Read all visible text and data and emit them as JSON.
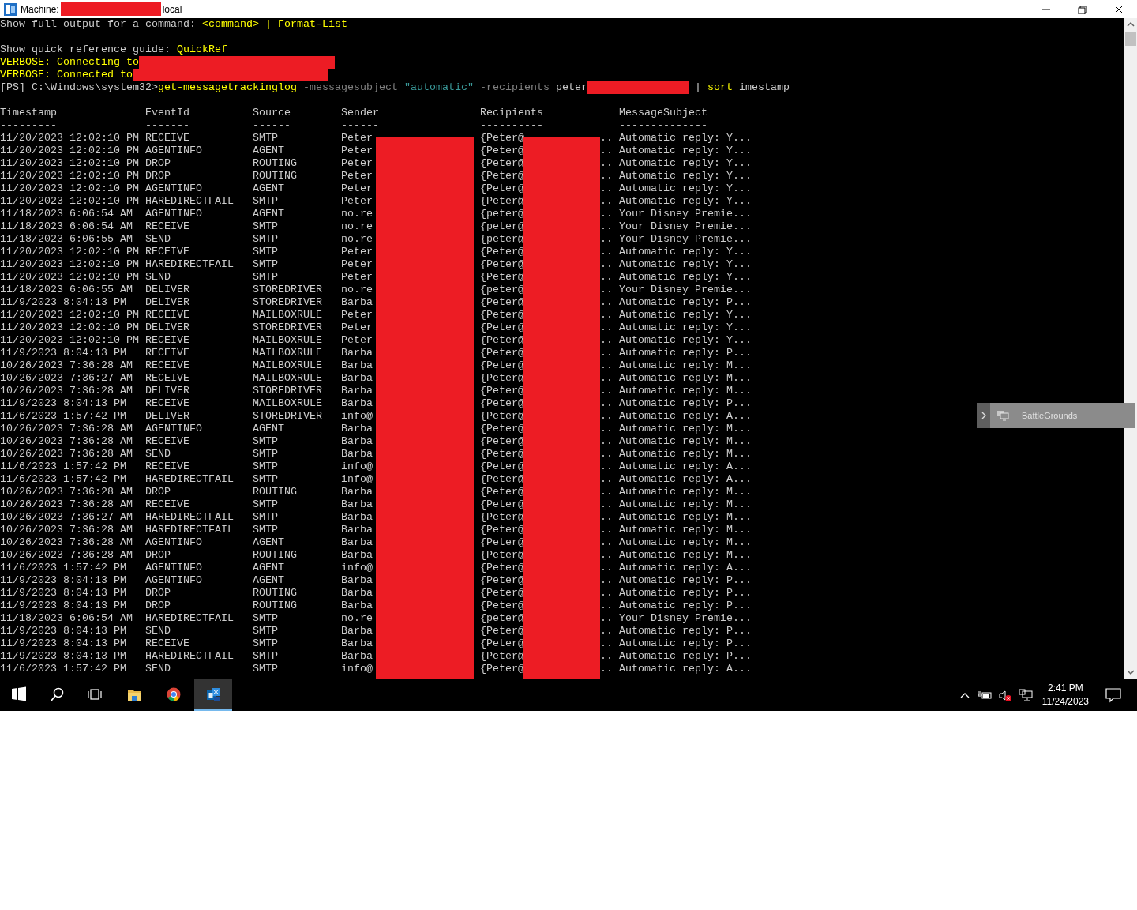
{
  "window": {
    "title": [
      {
        "kind": "plain",
        "text": "Machine:"
      },
      {
        "kind": "redaction"
      },
      {
        "kind": "plain",
        "text": "local"
      }
    ]
  },
  "console": {
    "lines": [
      {
        "blank_before": false,
        "segments": [
          {
            "kind": "plain",
            "text": "Show full output for a command: "
          },
          {
            "kind": "command",
            "text": "<command> | Format-List"
          }
        ]
      },
      {
        "blank_before": true,
        "segments": [
          {
            "kind": "plain",
            "text": "Show quick reference guide: "
          },
          {
            "kind": "command",
            "text": "QuickRef"
          }
        ]
      },
      {
        "blank_before": false,
        "segments": [
          {
            "kind": "command",
            "text": "VERBOSE: Connecting to"
          },
          {
            "kind": "redaction"
          }
        ]
      },
      {
        "blank_before": false,
        "segments": [
          {
            "kind": "command",
            "text": "VERBOSE: Connected to"
          },
          {
            "kind": "redaction"
          }
        ]
      },
      {
        "blank_before": false,
        "segments": [
          {
            "kind": "plain",
            "text": "[PS] C:\\Windows\\system32>"
          },
          {
            "kind": "command",
            "text": "get-messagetrackinglog"
          },
          {
            "kind": "parameter",
            "text": " -messagesubject "
          },
          {
            "kind": "string",
            "text": "\"automatic\""
          },
          {
            "kind": "parameter",
            "text": " -recipients "
          },
          {
            "kind": "plain",
            "text": "peter"
          },
          {
            "kind": "redaction"
          },
          {
            "kind": "plain",
            "text": " | "
          },
          {
            "kind": "command",
            "text": "sort"
          },
          {
            "kind": "plain",
            "text": " imestamp"
          }
        ]
      }
    ],
    "table": {
      "columns": [
        {
          "label": "Timestamp",
          "rule": "---------"
        },
        {
          "label": "EventId",
          "rule": "-------"
        },
        {
          "label": "Source",
          "rule": "------"
        },
        {
          "label": "Sender",
          "rule": "------"
        },
        {
          "label": "Recipients",
          "rule": "----------"
        },
        {
          "label": "MessageSubject",
          "rule": "--------------"
        }
      ],
      "rows": [
        {
          "timestamp": "11/20/2023 12:02:10 PM",
          "event_id": "RECEIVE",
          "source": "SMTP",
          "sender": "Peter",
          "recipients": "{Peter@",
          "recipients_end": "..",
          "subject": "Automatic reply: Y..."
        },
        {
          "timestamp": "11/20/2023 12:02:10 PM",
          "event_id": "AGENTINFO",
          "source": "AGENT",
          "sender": "Peter",
          "recipients": "{Peter@",
          "recipients_end": "..",
          "subject": "Automatic reply: Y..."
        },
        {
          "timestamp": "11/20/2023 12:02:10 PM",
          "event_id": "DROP",
          "source": "ROUTING",
          "sender": "Peter",
          "recipients": "{Peter@",
          "recipients_end": "..",
          "subject": "Automatic reply: Y..."
        },
        {
          "timestamp": "11/20/2023 12:02:10 PM",
          "event_id": "DROP",
          "source": "ROUTING",
          "sender": "Peter",
          "recipients": "{Peter@",
          "recipients_end": "..",
          "subject": "Automatic reply: Y..."
        },
        {
          "timestamp": "11/20/2023 12:02:10 PM",
          "event_id": "AGENTINFO",
          "source": "AGENT",
          "sender": "Peter",
          "recipients": "{Peter@",
          "recipients_end": "..",
          "subject": "Automatic reply: Y..."
        },
        {
          "timestamp": "11/20/2023 12:02:10 PM",
          "event_id": "HAREDIRECTFAIL",
          "source": "SMTP",
          "sender": "Peter",
          "recipients": "{Peter@",
          "recipients_end": "..",
          "subject": "Automatic reply: Y..."
        },
        {
          "timestamp": "11/18/2023 6:06:54 AM",
          "event_id": "AGENTINFO",
          "source": "AGENT",
          "sender": "no.re",
          "recipients": "{peter@",
          "recipients_end": "..",
          "subject": "Your Disney Premie..."
        },
        {
          "timestamp": "11/18/2023 6:06:54 AM",
          "event_id": "RECEIVE",
          "source": "SMTP",
          "sender": "no.re",
          "recipients": "{peter@",
          "recipients_end": "..",
          "subject": "Your Disney Premie..."
        },
        {
          "timestamp": "11/18/2023 6:06:55 AM",
          "event_id": "SEND",
          "source": "SMTP",
          "sender": "no.re",
          "recipients": "{peter@",
          "recipients_end": "..",
          "subject": "Your Disney Premie..."
        },
        {
          "timestamp": "11/20/2023 12:02:10 PM",
          "event_id": "RECEIVE",
          "source": "SMTP",
          "sender": "Peter",
          "recipients": "{Peter@",
          "recipients_end": "..",
          "subject": "Automatic reply: Y..."
        },
        {
          "timestamp": "11/20/2023 12:02:10 PM",
          "event_id": "HAREDIRECTFAIL",
          "source": "SMTP",
          "sender": "Peter",
          "recipients": "{Peter@",
          "recipients_end": "..",
          "subject": "Automatic reply: Y..."
        },
        {
          "timestamp": "11/20/2023 12:02:10 PM",
          "event_id": "SEND",
          "source": "SMTP",
          "sender": "Peter",
          "recipients": "{Peter@",
          "recipients_end": "..",
          "subject": "Automatic reply: Y..."
        },
        {
          "timestamp": "11/18/2023 6:06:55 AM",
          "event_id": "DELIVER",
          "source": "STOREDRIVER",
          "sender": "no.re",
          "recipients": "{peter@",
          "recipients_end": "..",
          "subject": "Your Disney Premie..."
        },
        {
          "timestamp": "11/9/2023 8:04:13 PM",
          "event_id": "DELIVER",
          "source": "STOREDRIVER",
          "sender": "Barba",
          "recipients": "{Peter@",
          "recipients_end": "..",
          "subject": "Automatic reply: P..."
        },
        {
          "timestamp": "11/20/2023 12:02:10 PM",
          "event_id": "RECEIVE",
          "source": "MAILBOXRULE",
          "sender": "Peter",
          "recipients": "{Peter@",
          "recipients_end": "..",
          "subject": "Automatic reply: Y..."
        },
        {
          "timestamp": "11/20/2023 12:02:10 PM",
          "event_id": "DELIVER",
          "source": "STOREDRIVER",
          "sender": "Peter",
          "recipients": "{Peter@",
          "recipients_end": "..",
          "subject": "Automatic reply: Y..."
        },
        {
          "timestamp": "11/20/2023 12:02:10 PM",
          "event_id": "RECEIVE",
          "source": "MAILBOXRULE",
          "sender": "Peter",
          "recipients": "{Peter@",
          "recipients_end": "..",
          "subject": "Automatic reply: Y..."
        },
        {
          "timestamp": "11/9/2023 8:04:13 PM",
          "event_id": "RECEIVE",
          "source": "MAILBOXRULE",
          "sender": "Barba",
          "recipients": "{Peter@",
          "recipients_end": "..",
          "subject": "Automatic reply: P..."
        },
        {
          "timestamp": "10/26/2023 7:36:28 AM",
          "event_id": "RECEIVE",
          "source": "MAILBOXRULE",
          "sender": "Barba",
          "recipients": "{Peter@",
          "recipients_end": "..",
          "subject": "Automatic reply: M..."
        },
        {
          "timestamp": "10/26/2023 7:36:27 AM",
          "event_id": "RECEIVE",
          "source": "MAILBOXRULE",
          "sender": "Barba",
          "recipients": "{Peter@",
          "recipients_end": "..",
          "subject": "Automatic reply: M..."
        },
        {
          "timestamp": "10/26/2023 7:36:28 AM",
          "event_id": "DELIVER",
          "source": "STOREDRIVER",
          "sender": "Barba",
          "recipients": "{Peter@",
          "recipients_end": "..",
          "subject": "Automatic reply: M..."
        },
        {
          "timestamp": "11/9/2023 8:04:13 PM",
          "event_id": "RECEIVE",
          "source": "MAILBOXRULE",
          "sender": "Barba",
          "recipients": "{Peter@",
          "recipients_end": "..",
          "subject": "Automatic reply: P..."
        },
        {
          "timestamp": "11/6/2023 1:57:42 PM",
          "event_id": "DELIVER",
          "source": "STOREDRIVER",
          "sender": "info@",
          "recipients": "{Peter@",
          "recipients_end": "..",
          "subject": "Automatic reply: A..."
        },
        {
          "timestamp": "10/26/2023 7:36:28 AM",
          "event_id": "AGENTINFO",
          "source": "AGENT",
          "sender": "Barba",
          "recipients": "{Peter@",
          "recipients_end": "..",
          "subject": "Automatic reply: M..."
        },
        {
          "timestamp": "10/26/2023 7:36:28 AM",
          "event_id": "RECEIVE",
          "source": "SMTP",
          "sender": "Barba",
          "recipients": "{Peter@",
          "recipients_end": "..",
          "subject": "Automatic reply: M..."
        },
        {
          "timestamp": "10/26/2023 7:36:28 AM",
          "event_id": "SEND",
          "source": "SMTP",
          "sender": "Barba",
          "recipients": "{Peter@",
          "recipients_end": "..",
          "subject": "Automatic reply: M..."
        },
        {
          "timestamp": "11/6/2023 1:57:42 PM",
          "event_id": "RECEIVE",
          "source": "SMTP",
          "sender": "info@",
          "recipients": "{Peter@",
          "recipients_end": "..",
          "subject": "Automatic reply: A..."
        },
        {
          "timestamp": "11/6/2023 1:57:42 PM",
          "event_id": "HAREDIRECTFAIL",
          "source": "SMTP",
          "sender": "info@",
          "recipients": "{Peter@",
          "recipients_end": "..",
          "subject": "Automatic reply: A..."
        },
        {
          "timestamp": "10/26/2023 7:36:28 AM",
          "event_id": "DROP",
          "source": "ROUTING",
          "sender": "Barba",
          "recipients": "{Peter@",
          "recipients_end": "..",
          "subject": "Automatic reply: M..."
        },
        {
          "timestamp": "10/26/2023 7:36:28 AM",
          "event_id": "RECEIVE",
          "source": "SMTP",
          "sender": "Barba",
          "recipients": "{Peter@",
          "recipients_end": "..",
          "subject": "Automatic reply: M..."
        },
        {
          "timestamp": "10/26/2023 7:36:27 AM",
          "event_id": "HAREDIRECTFAIL",
          "source": "SMTP",
          "sender": "Barba",
          "recipients": "{Peter@",
          "recipients_end": "..",
          "subject": "Automatic reply: M..."
        },
        {
          "timestamp": "10/26/2023 7:36:28 AM",
          "event_id": "HAREDIRECTFAIL",
          "source": "SMTP",
          "sender": "Barba",
          "recipients": "{Peter@",
          "recipients_end": "..",
          "subject": "Automatic reply: M..."
        },
        {
          "timestamp": "10/26/2023 7:36:28 AM",
          "event_id": "AGENTINFO",
          "source": "AGENT",
          "sender": "Barba",
          "recipients": "{Peter@",
          "recipients_end": "..",
          "subject": "Automatic reply: M..."
        },
        {
          "timestamp": "10/26/2023 7:36:28 AM",
          "event_id": "DROP",
          "source": "ROUTING",
          "sender": "Barba",
          "recipients": "{Peter@",
          "recipients_end": "..",
          "subject": "Automatic reply: M..."
        },
        {
          "timestamp": "11/6/2023 1:57:42 PM",
          "event_id": "AGENTINFO",
          "source": "AGENT",
          "sender": "info@",
          "recipients": "{Peter@",
          "recipients_end": "..",
          "subject": "Automatic reply: A..."
        },
        {
          "timestamp": "11/9/2023 8:04:13 PM",
          "event_id": "AGENTINFO",
          "source": "AGENT",
          "sender": "Barba",
          "recipients": "{Peter@",
          "recipients_end": "..",
          "subject": "Automatic reply: P..."
        },
        {
          "timestamp": "11/9/2023 8:04:13 PM",
          "event_id": "DROP",
          "source": "ROUTING",
          "sender": "Barba",
          "recipients": "{Peter@",
          "recipients_end": "..",
          "subject": "Automatic reply: P..."
        },
        {
          "timestamp": "11/9/2023 8:04:13 PM",
          "event_id": "DROP",
          "source": "ROUTING",
          "sender": "Barba",
          "recipients": "{Peter@",
          "recipients_end": "..",
          "subject": "Automatic reply: P..."
        },
        {
          "timestamp": "11/18/2023 6:06:54 AM",
          "event_id": "HAREDIRECTFAIL",
          "source": "SMTP",
          "sender": "no.re",
          "recipients": "{peter@",
          "recipients_end": "..",
          "subject": "Your Disney Premie..."
        },
        {
          "timestamp": "11/9/2023 8:04:13 PM",
          "event_id": "SEND",
          "source": "SMTP",
          "sender": "Barba",
          "recipients": "{Peter@",
          "recipients_end": "..",
          "subject": "Automatic reply: P..."
        },
        {
          "timestamp": "11/9/2023 8:04:13 PM",
          "event_id": "RECEIVE",
          "source": "SMTP",
          "sender": "Barba",
          "recipients": "{Peter@",
          "recipients_end": "..",
          "subject": "Automatic reply: P..."
        },
        {
          "timestamp": "11/9/2023 8:04:13 PM",
          "event_id": "HAREDIRECTFAIL",
          "source": "SMTP",
          "sender": "Barba",
          "recipients": "{Peter@",
          "recipients_end": "..",
          "subject": "Automatic reply: P..."
        },
        {
          "timestamp": "11/6/2023 1:57:42 PM",
          "event_id": "SEND",
          "source": "SMTP",
          "sender": "info@",
          "recipients": "{Peter@",
          "recipients_end": "..",
          "subject": "Automatic reply: A..."
        }
      ]
    }
  },
  "popup": {
    "label": "BattleGrounds"
  },
  "taskbar": {
    "apps": [
      {
        "kind": "start",
        "selected": false
      },
      {
        "kind": "search",
        "selected": false
      },
      {
        "kind": "task-view",
        "selected": false
      },
      {
        "kind": "folder",
        "selected": false
      },
      {
        "kind": "browser",
        "selected": false
      },
      {
        "kind": "mail-app",
        "selected": true
      }
    ],
    "clock": {
      "time": "2:41 PM",
      "date": "11/24/2023"
    }
  }
}
